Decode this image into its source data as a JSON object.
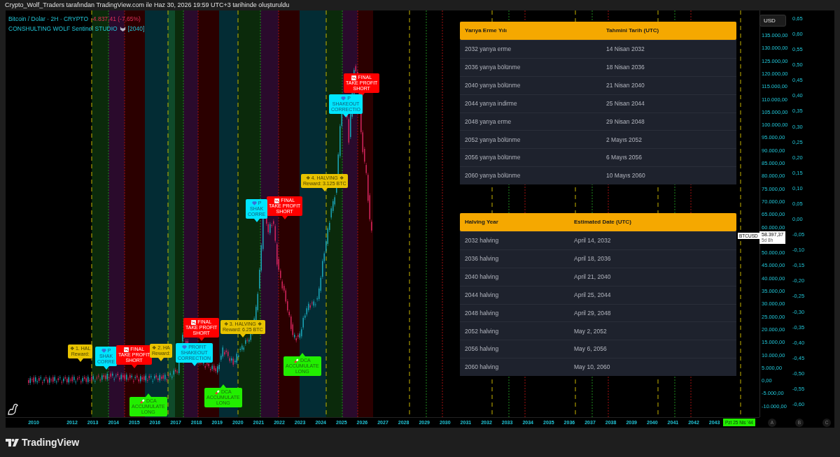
{
  "header": {
    "text": "Crypto_Wolf_Traders tarafından TradingView.com ile Haz 30, 2026 19:59 UTC+3 tarihinde oluşturuldu"
  },
  "legend": {
    "symbol": "Bitcoin / Dolar · 2H · CRYPTO",
    "change": "-4.837,41 (-7,65%)",
    "indicator": "CONSHULTING WOLF Sentinel STUDIO",
    "indicator_param": "[2040]"
  },
  "chart_labels": [
    {
      "kind": "final",
      "lines": [
        "FINAL",
        "TAKE PROFIT",
        "SHORT"
      ]
    },
    {
      "kind": "profit",
      "lines": [
        "P",
        "SHAKEOUT",
        "CORRECTIO"
      ]
    },
    {
      "kind": "halving",
      "lines": [
        "❖ 4. HALVING ❖",
        "Reward: 3.125 BTC"
      ]
    },
    {
      "kind": "final",
      "lines": [
        "FINAL",
        "TAKE PROFIT",
        "SHORT"
      ]
    },
    {
      "kind": "profit",
      "lines": [
        "P",
        "SHAK",
        "CORRE"
      ]
    },
    {
      "kind": "final",
      "lines": [
        "FINAL",
        "TAKE PROFIT",
        "SHORT"
      ]
    },
    {
      "kind": "halving",
      "lines": [
        "❖ 3. HALVING ❖",
        "Reward: 6.25 BTC"
      ]
    },
    {
      "kind": "halving",
      "lines": [
        "❖ 1. HAL",
        "Reward:"
      ]
    },
    {
      "kind": "profit",
      "lines": [
        "P",
        "SHAK",
        "CORRE"
      ]
    },
    {
      "kind": "final",
      "lines": [
        "FINAL",
        "TAKE PROFIT",
        "SHORT"
      ]
    },
    {
      "kind": "halving",
      "lines": [
        "❖ 2. HA",
        "Reward:"
      ]
    },
    {
      "kind": "profit",
      "lines": [
        "PROFIT",
        "SHAKEOUT",
        "CORRECTION"
      ]
    },
    {
      "kind": "dca",
      "lines": [
        "DCA",
        "ACCUMULATE",
        "LONG"
      ]
    },
    {
      "kind": "dca",
      "lines": [
        "DCA",
        "ACCUMULATE",
        "LONG"
      ]
    },
    {
      "kind": "dca",
      "lines": [
        "DCA",
        "ACCUMULATE",
        "LONG"
      ]
    }
  ],
  "table_tr": {
    "columns": [
      "Yarıya Erme Yılı",
      "Tahmini Tarih (UTC)"
    ],
    "rows": [
      [
        "2032 yarıya erme",
        "14 Nisan 2032"
      ],
      [
        "2036 yarıya bölünme",
        "18 Nisan 2036"
      ],
      [
        "2040 yarıya bölünme",
        "21 Nisan 2040"
      ],
      [
        "2044 yarıya indirme",
        "25 Nisan 2044"
      ],
      [
        "2048 yarıya erme",
        "29 Nisan 2048"
      ],
      [
        "2052 yarıya bölünme",
        "2 Mayıs 2052"
      ],
      [
        "2056 yarıya bölünme",
        "6 Mayıs 2056"
      ],
      [
        "2060 yarıya bölünme",
        "10 Mayıs 2060"
      ]
    ]
  },
  "table_en": {
    "columns": [
      "Halving Year",
      "Estimated Date (UTC)"
    ],
    "rows": [
      [
        "2032 halving",
        "April 14, 2032"
      ],
      [
        "2036 halving",
        "April 18, 2036"
      ],
      [
        "2040 halving",
        "April 21, 2040"
      ],
      [
        "2044 halving",
        "April 25, 2044"
      ],
      [
        "2048 halving",
        "April 29, 2048"
      ],
      [
        "2052 halving",
        "May 2, 2052"
      ],
      [
        "2056 halving",
        "May 6, 2056"
      ],
      [
        "2060 halving",
        "May 10, 2060"
      ]
    ]
  },
  "currency_button": "USD",
  "price_axis": [
    "135.000,00",
    "130.000,00",
    "125.000,00",
    "120.000,00",
    "115.000,00",
    "110.000,00",
    "105.000,00",
    "100.000,00",
    "95.000,00",
    "90.000,00",
    "85.000,00",
    "80.000,00",
    "75.000,00",
    "70.000,00",
    "65.000,00",
    "60.000,00",
    "50.000,00",
    "45.000,00",
    "40.000,00",
    "35.000,00",
    "30.000,00",
    "25.000,00",
    "20.000,00",
    "15.000,00",
    "10.000,00",
    "5.000,00",
    "0,00",
    "-5.000,00",
    "-10.000,00"
  ],
  "percent_axis": [
    "0,65",
    "0,60",
    "0,55",
    "0,50",
    "0,45",
    "0,40",
    "0,35",
    "0,30",
    "0,25",
    "0,20",
    "0,15",
    "0,10",
    "0,05",
    "0,00",
    "-0,05",
    "-0,10",
    "-0,15",
    "-0,20",
    "-0,25",
    "-0,30",
    "-0,35",
    "-0,40",
    "-0,45",
    "-0,50",
    "-0,55",
    "-0,60"
  ],
  "symbol_tag": "BTCUSD",
  "last_price": "58.397,37",
  "countdown": "5d 8h",
  "time_axis": [
    "2010",
    "2012",
    "2013",
    "2014",
    "2015",
    "2016",
    "2017",
    "2018",
    "2019",
    "2020",
    "2021",
    "2022",
    "2023",
    "2024",
    "2025",
    "2026",
    "2027",
    "2028",
    "2029",
    "2030",
    "2031",
    "2032",
    "2033",
    "2034",
    "2035",
    "2036",
    "2037",
    "2038",
    "2039",
    "2040",
    "2041",
    "2042",
    "2043"
  ],
  "cursor_date": "Pzt 25 Nis '44",
  "scale_buttons": [
    "A",
    "B",
    "C"
  ],
  "brand": "TradingView"
}
